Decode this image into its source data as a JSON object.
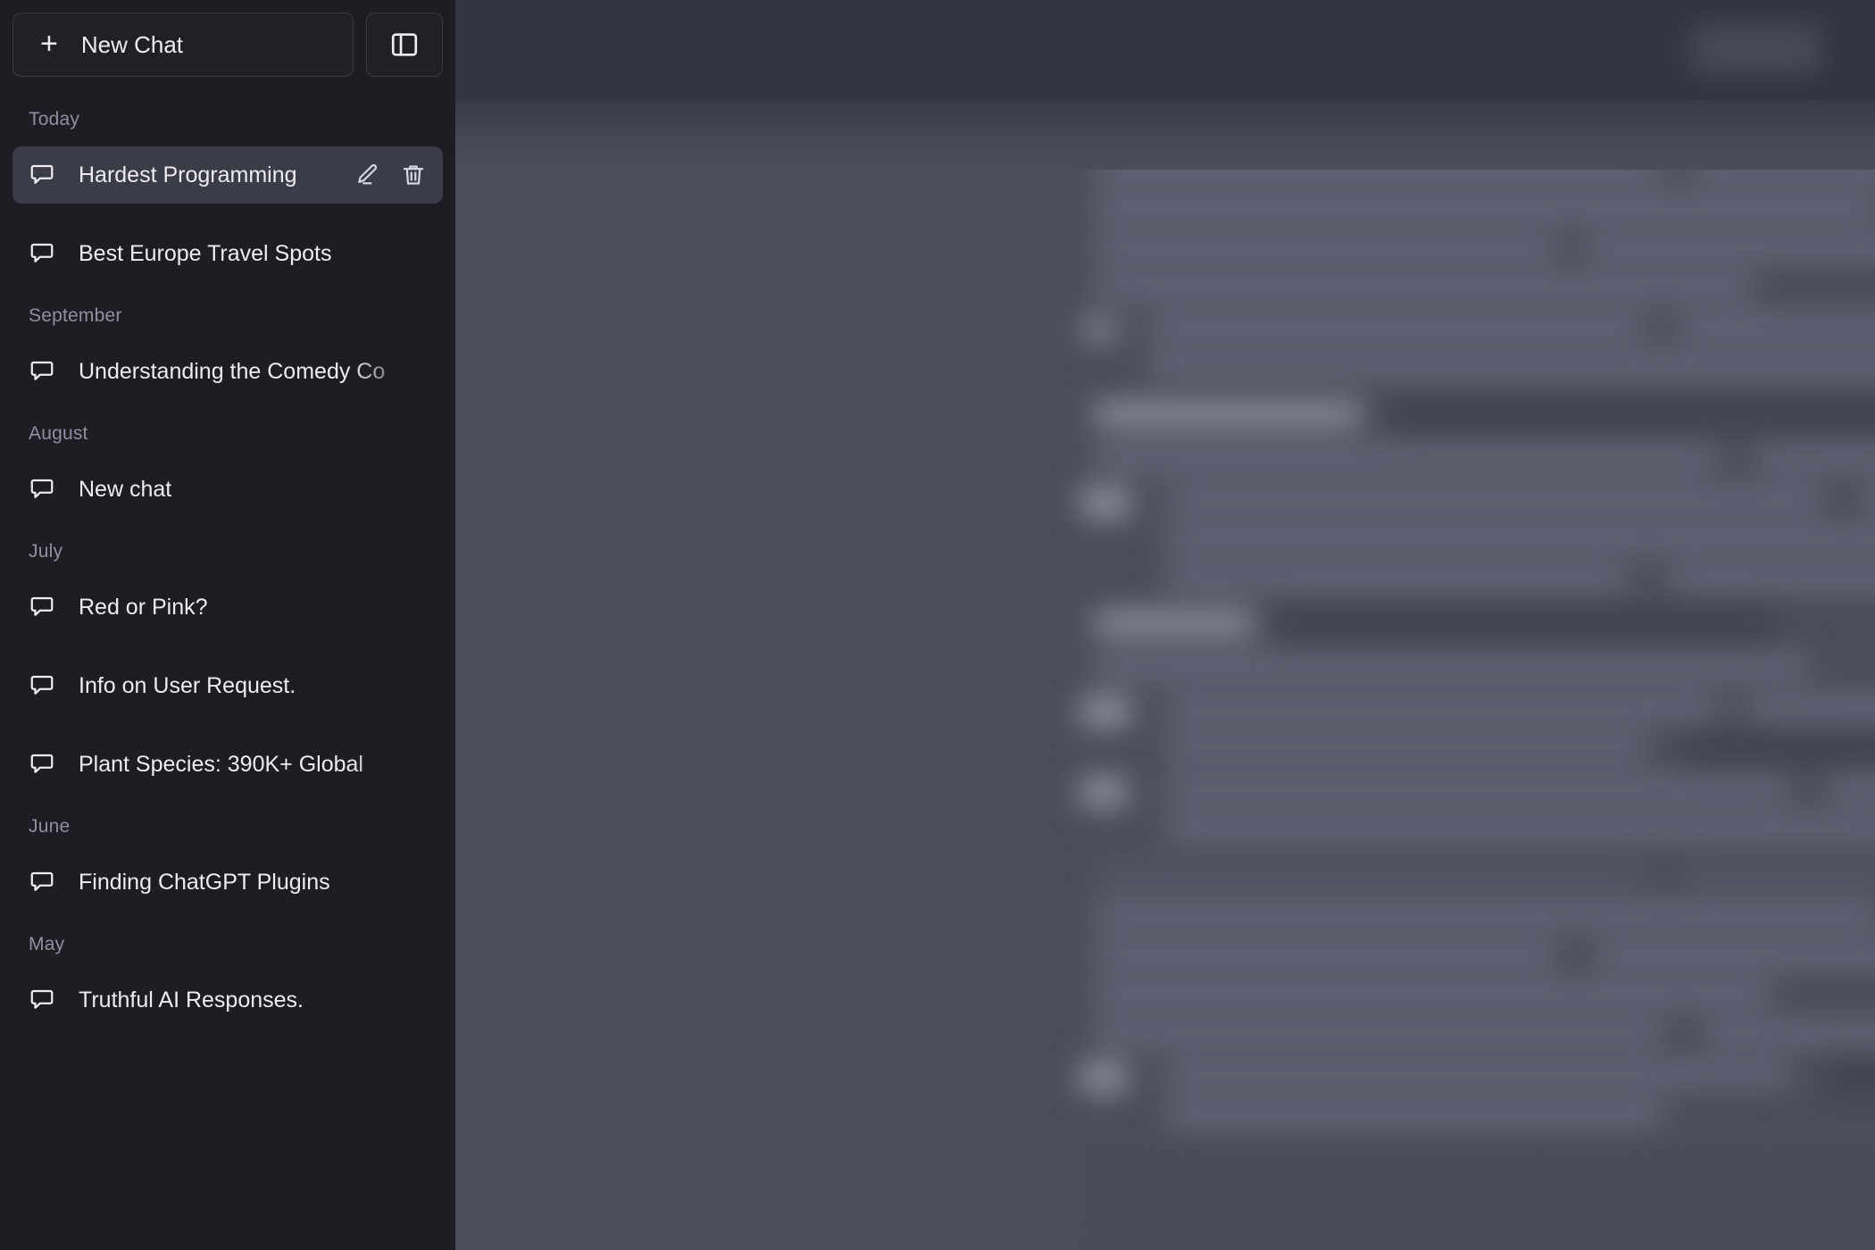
{
  "sidebar": {
    "new_chat_label": "New Chat",
    "new_chat_icon": "plus-icon",
    "toggle_icon": "sidebar-toggle-icon",
    "groups": [
      {
        "label": "Today",
        "items": [
          {
            "title": "Hardest Programming",
            "icon": "message-bubble-icon",
            "active": true,
            "truncated": false
          },
          {
            "title": "Best Europe Travel Spots",
            "icon": "message-bubble-icon",
            "active": false,
            "truncated": false
          }
        ]
      },
      {
        "label": "September",
        "items": [
          {
            "title": "Understanding the Comedy Co",
            "icon": "message-bubble-icon",
            "active": false,
            "truncated": true
          }
        ]
      },
      {
        "label": "August",
        "items": [
          {
            "title": "New chat",
            "icon": "message-bubble-icon",
            "active": false,
            "truncated": false
          }
        ]
      },
      {
        "label": "July",
        "items": [
          {
            "title": "Red or Pink?",
            "icon": "message-bubble-icon",
            "active": false,
            "truncated": false
          },
          {
            "title": "Info on User Request.",
            "icon": "message-bubble-icon",
            "active": false,
            "truncated": false
          },
          {
            "title": "Plant Species: 390K+ Global",
            "icon": "message-bubble-icon",
            "active": false,
            "truncated": true
          }
        ]
      },
      {
        "label": "June",
        "items": [
          {
            "title": "Finding ChatGPT Plugins",
            "icon": "message-bubble-icon",
            "active": false,
            "truncated": false
          }
        ]
      },
      {
        "label": "May",
        "items": [
          {
            "title": "Truthful AI Responses.",
            "icon": "message-bubble-icon",
            "active": false,
            "truncated": false
          }
        ]
      }
    ],
    "row_actions": {
      "edit_icon": "pencil-edit-icon",
      "delete_icon": "trash-delete-icon"
    }
  },
  "main": {
    "content_state": "blurred-conversation",
    "description": "Chat conversation content is visually blurred and unreadable"
  },
  "colors": {
    "sidebar_bg": "#1d1e23",
    "sidebar_row_active": "#3a3c48",
    "sidebar_border": "#3a3b42",
    "main_bg": "#4b4d5c",
    "main_header_bg": "#32343f",
    "text_primary": "#ececf1",
    "text_muted": "#8e8fa0"
  }
}
